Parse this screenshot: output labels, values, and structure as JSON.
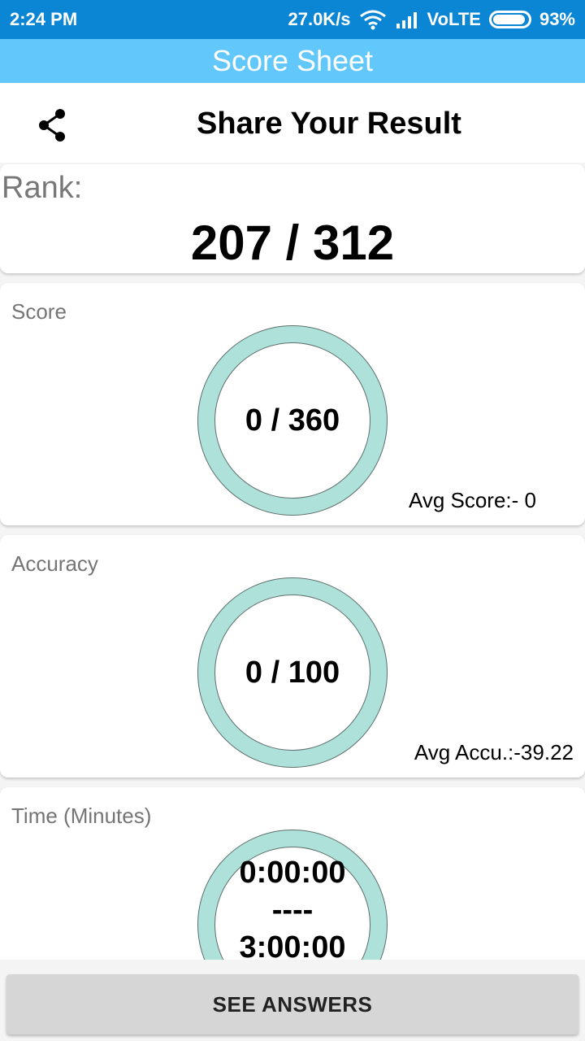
{
  "status_bar": {
    "time": "2:24 PM",
    "network_speed": "27.0K/s",
    "network_type": "VoLTE",
    "battery_percent": "93%",
    "battery_level": 0.93,
    "icons": [
      "wifi-icon",
      "signal-icon",
      "battery-icon"
    ]
  },
  "app_bar": {
    "title": "Score Sheet",
    "color": "#62c8fb"
  },
  "header": {
    "share_icon": "share-icon",
    "title": "Share Your Result"
  },
  "rank": {
    "label": "Rank:",
    "value": "207 / 312"
  },
  "score": {
    "title": "Score",
    "value": "0 / 360",
    "avg": "Avg Score:- 0"
  },
  "accuracy": {
    "title": "Accuracy",
    "value": "0 / 100",
    "avg": "Avg Accu.:-39.22"
  },
  "time": {
    "title": "Time (Minutes)",
    "taken": "0:00:00",
    "separator": "----",
    "total": "3:00:00"
  },
  "footer": {
    "button_label": "SEE ANSWERS"
  },
  "colors": {
    "status_bar": "#0b86d4",
    "ring": "#ade1da"
  }
}
